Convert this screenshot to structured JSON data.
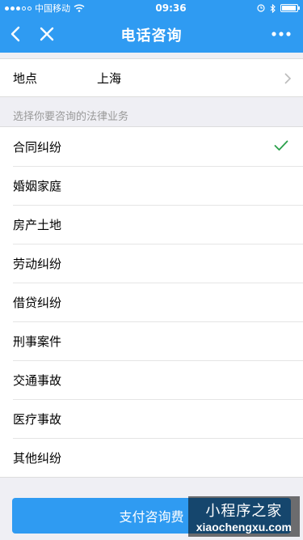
{
  "status_bar": {
    "carrier": "中国移动",
    "time": "09:36"
  },
  "nav": {
    "title": "电话咨询",
    "back_icon": "back-arrow-icon",
    "close_icon": "close-icon",
    "more_icon": "more-dots-icon"
  },
  "location": {
    "label": "地点",
    "value": "上海"
  },
  "section": {
    "title": "选择你要咨询的法律业务"
  },
  "services": [
    {
      "label": "合同纠纷",
      "selected": true
    },
    {
      "label": "婚姻家庭",
      "selected": false
    },
    {
      "label": "房产土地",
      "selected": false
    },
    {
      "label": "劳动纠纷",
      "selected": false
    },
    {
      "label": "借贷纠纷",
      "selected": false
    },
    {
      "label": "刑事案件",
      "selected": false
    },
    {
      "label": "交通事故",
      "selected": false
    },
    {
      "label": "医疗事故",
      "selected": false
    },
    {
      "label": "其他纠纷",
      "selected": false
    }
  ],
  "pay_button": {
    "label": "支付咨询费"
  },
  "watermark": {
    "cn": "小程序之家",
    "en": "xiaochengxu.com"
  },
  "colors": {
    "accent": "#2f9bf2",
    "check": "#2aa04a",
    "background": "#efeff4"
  }
}
